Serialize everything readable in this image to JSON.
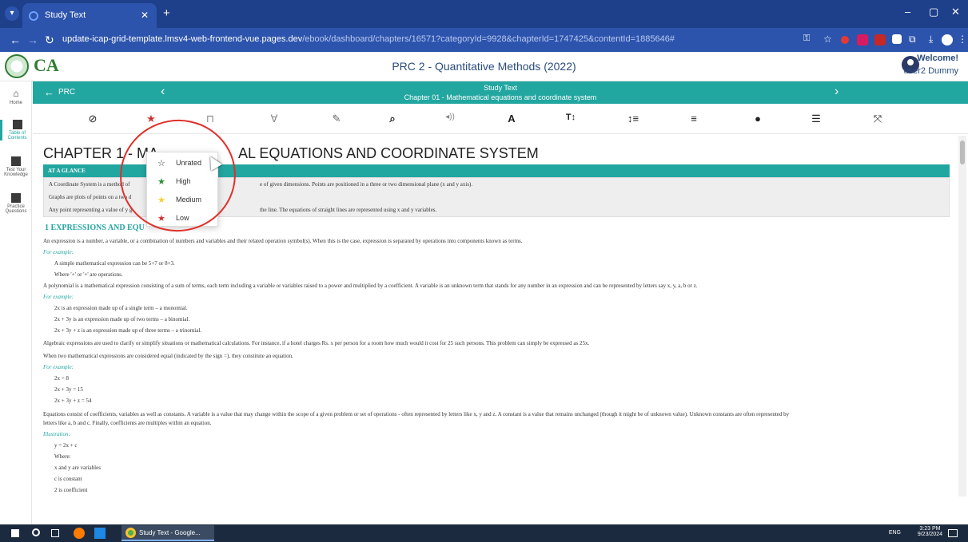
{
  "browser": {
    "tab_title": "Study Text",
    "url_host": "update-icap-grid-template.lmsv4-web-frontend-vue.pages.dev",
    "url_path": "/ebook/dashboard/chapters/16571?categoryId=9928&chapterId=1747425&contentId=1885646#"
  },
  "header": {
    "logo_text": "CA",
    "title": "PRC 2 - Quantitative Methods (2022)",
    "welcome": "Welcome!",
    "user": "user2 Dummy"
  },
  "sidebar": {
    "items": [
      {
        "label": "Home"
      },
      {
        "label": "Table of Contents"
      },
      {
        "label": "Test Your Knowledge"
      },
      {
        "label": "Practice Questions"
      }
    ]
  },
  "breadcrumb_bar": {
    "back_label": "PRC",
    "title": "Study Text",
    "subtitle": "Chapter 01 - Mathematical equations and coordinate system"
  },
  "rating_menu": {
    "options": [
      {
        "label": "Unrated",
        "color": "#555555"
      },
      {
        "label": "High",
        "color": "#2e8b3a"
      },
      {
        "label": "Medium",
        "color": "#f2d22e"
      },
      {
        "label": "Low",
        "color": "#d32f2f"
      }
    ]
  },
  "content": {
    "chapter_title_left": "CHAPTER 1 - MA",
    "chapter_title_right": "AL EQUATIONS AND COORDINATE SYSTEM",
    "glance_heading": "AT A GLANCE",
    "glance": [
      "A Coordinate System is a method of",
      "Graphs are plots of points on a two d",
      "Any point representing a value of y g"
    ],
    "glance_right": [
      "e of given dimensions. Points are positioned in a three or two dimensional plane (x and y axis).",
      "",
      "the line. The equations of straight lines are represented using x and y variables."
    ],
    "section_title": "1   EXPRESSIONS AND EQU",
    "body": [
      "An expression is a number, a variable, or a combination of numbers and variables and their related operation symbol(s). When this is the case, expression is separated by operations into components known as terms.",
      "For example:",
      "A simple mathematical expression can be 5+7 or 8+3.",
      "Where '+' or '+' are operations.",
      "A polynomial is a mathematical expression consisting of a sum of terms, each term including a variable or variables raised to a power and multiplied by a coefficient. A variable is an unknown term that stands for any number in an expression and can be represented by letters say x, y, a, b or z.",
      "For example:",
      "2x is an expression made up of a single term – a monomial.",
      "2x + 3y is an expression made up of two terms – a binomial.",
      "2x + 3y + z is an expression made up of three terms – a trinomial.",
      "Algebraic expressions are used to clarify or simplify situations or mathematical calculations. For instance, if a hotel charges Rs. x per person for a room how much would it cost for 25 such persons. This problem can simply be expressed as 25x.",
      "When two mathematical expressions are considered equal (indicated by the sign =), they constitute an equation.",
      "For example:",
      "2x = 8",
      "2x + 3y = 15",
      "2x + 3y + z = 54",
      "Equations consist of coefficients, variables as well as constants. A variable is a value that may change within the scope of a given problem or set of operations - often represented by letters like x, y and z. A constant is a value that remains unchanged (though it might be of unknown value). Unknown constants are often represented by",
      "letters like a, b and c. Finally, coefficients are multiples within an equation.",
      "Illustration:",
      "y = 2x + c",
      "Where:",
      "x and y are variables",
      "c is constant",
      "2 is coefficient"
    ]
  },
  "taskbar": {
    "task_label": "Study Text - Google...",
    "lang": "ENG",
    "time": "3:23 PM",
    "date": "9/23/2024"
  }
}
